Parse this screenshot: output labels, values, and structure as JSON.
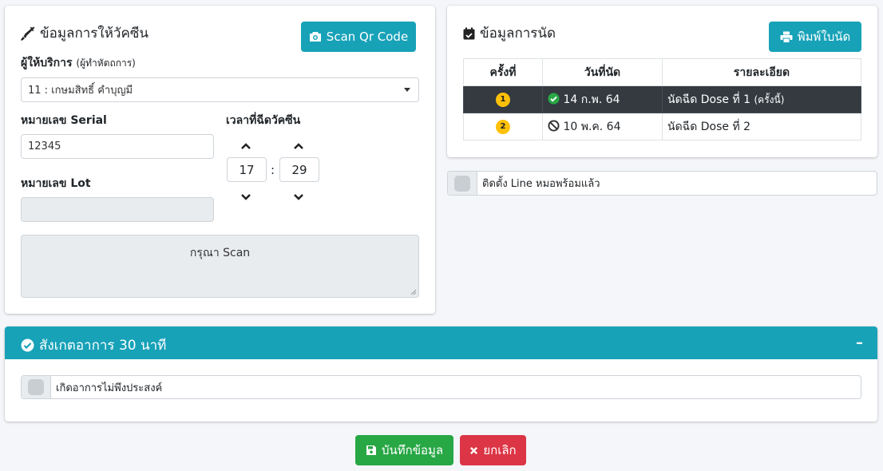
{
  "vaccine_card": {
    "title": "ข้อมูลการให้วัคซีน",
    "scan_button": "Scan Qr Code",
    "provider_label": "ผู้ให้บริการ",
    "provider_sublabel": "(ผู้ทำหัตถการ)",
    "provider_value": "11 : เกษมสิทธิ์ คำบุญมี",
    "serial_label": "หมายเลข Serial",
    "serial_value": "12345",
    "lot_label": "หมายเลข Lot",
    "lot_value": "",
    "time_label": "เวลาที่ฉีดวัคซีน",
    "hour": "17",
    "minute": "29",
    "time_separator": ":",
    "scan_placeholder": "กรุณา Scan"
  },
  "appointment_card": {
    "title": "ข้อมูลการนัด",
    "print_button": "พิมพ์ใบนัด",
    "columns": [
      "ครั้งที่",
      "วันที่นัด",
      "รายละเอียด"
    ],
    "rows": [
      {
        "no": "1",
        "date": "14 ก.พ. 64",
        "detail": "นัดฉีด Dose ที่ 1",
        "detail_note": "(ครั้งนี้)",
        "status_icon": "check-circle-icon"
      },
      {
        "no": "2",
        "date": "10 พ.ค. 64",
        "detail": "นัดฉีด Dose ที่ 2",
        "detail_note": "",
        "status_icon": "ban-icon"
      }
    ]
  },
  "line_checkbox": {
    "label": "ติดตั้ง Line หมอพร้อมแล้ว",
    "checked": false
  },
  "observation": {
    "title": "สังเกตอาการ 30 นาที",
    "collapse_symbol": "–",
    "checkbox_label": "เกิดอาการไม่พึงประสงค์",
    "checked": false
  },
  "actions": {
    "save": "บันทึกข้อมูล",
    "cancel": "ยกเลิก"
  },
  "colors": {
    "info": "#17a2b8",
    "success": "#28a745",
    "danger": "#dc3545",
    "warning": "#ffc107",
    "dark": "#343a40"
  }
}
